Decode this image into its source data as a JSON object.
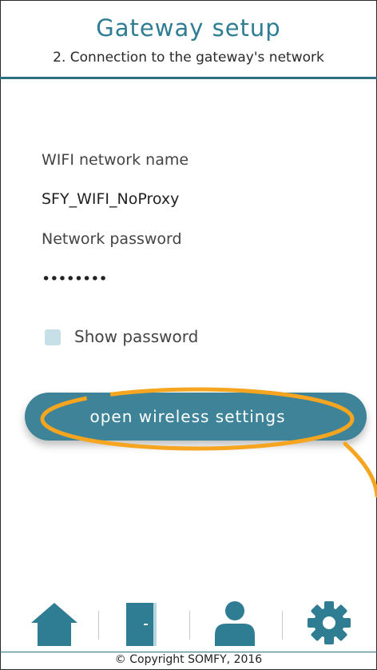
{
  "header": {
    "title": "Gateway setup",
    "subtitle": "2. Connection to the gateway's network"
  },
  "form": {
    "wifi_label": "WIFI network name",
    "wifi_value": "SFY_WIFI_NoProxy",
    "password_label": "Network password",
    "password_value": "••••••••",
    "show_password_label": "Show password",
    "show_password_checked": false
  },
  "button": {
    "label": "open wireless settings"
  },
  "tabbar": {
    "items": [
      {
        "icon": "home-icon"
      },
      {
        "icon": "door-icon"
      },
      {
        "icon": "user-icon"
      },
      {
        "icon": "gear-icon"
      }
    ]
  },
  "footer": {
    "copyright": "© Copyright SOMFY, 2016"
  },
  "colors": {
    "accent": "#2e7d93",
    "button": "#3e8397",
    "highlight": "#f5a51f",
    "checkbox": "#c7dfe7"
  }
}
